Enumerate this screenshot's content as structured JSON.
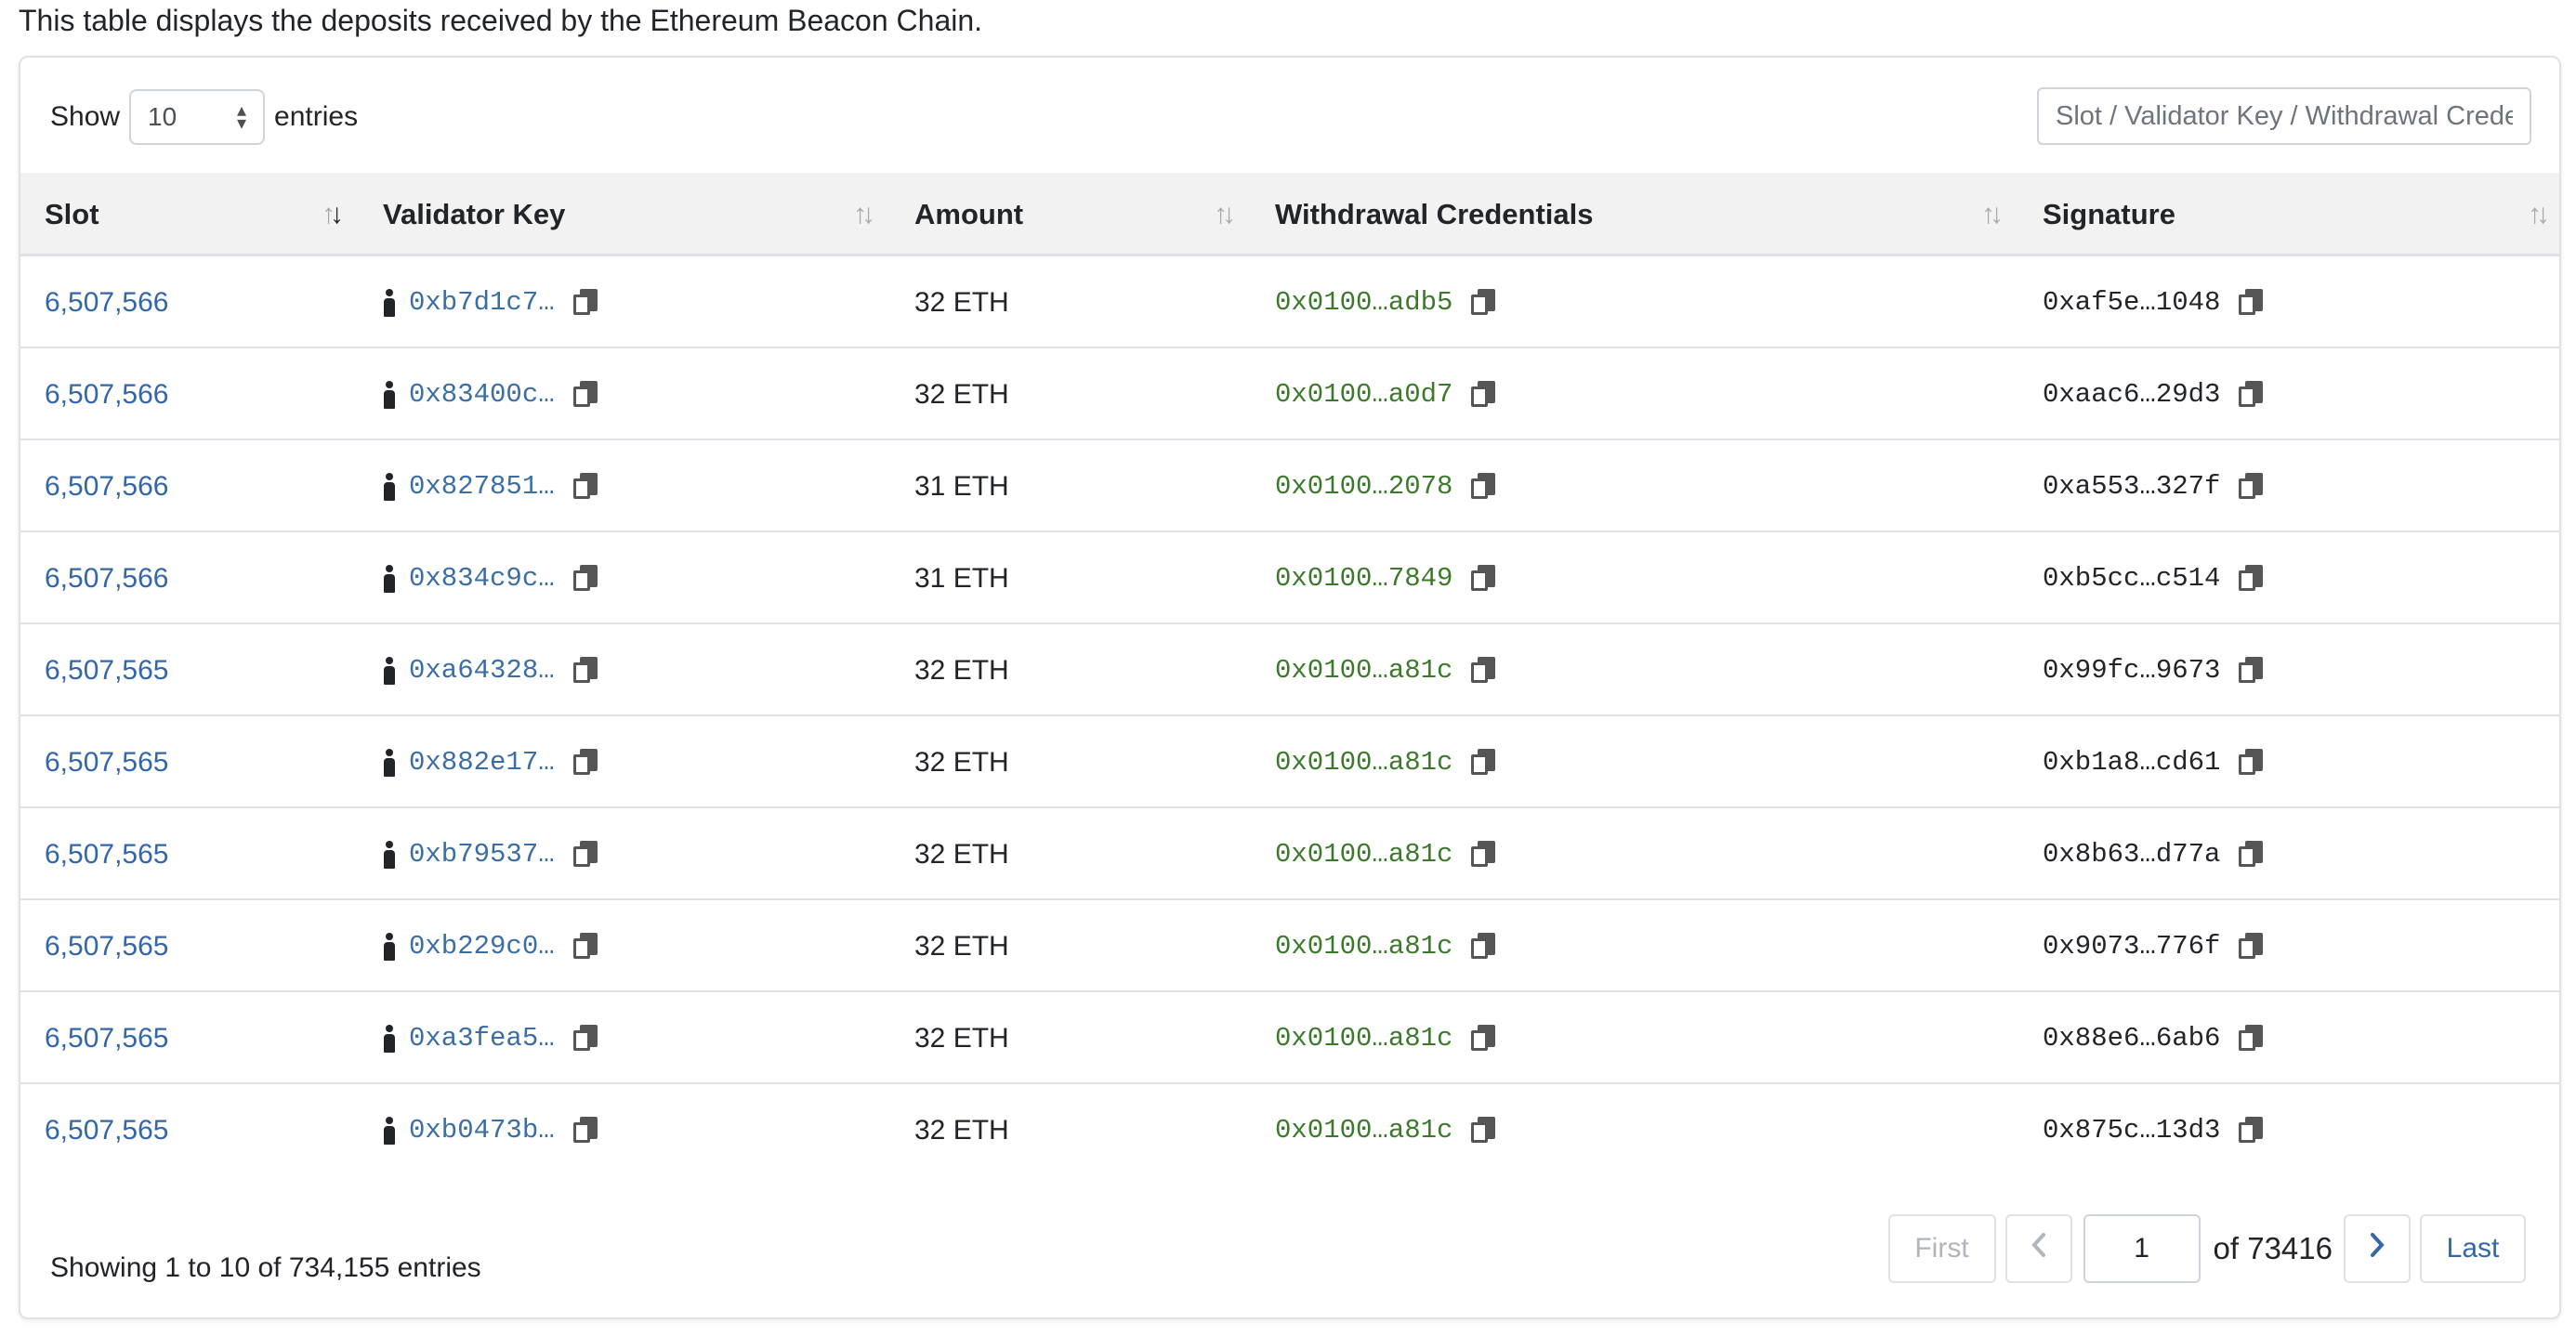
{
  "description": "This table displays the deposits received by the Ethereum Beacon Chain.",
  "length_menu": {
    "show_label": "Show",
    "selected": "10",
    "entries_label": "entries"
  },
  "search": {
    "placeholder": "Slot / Validator Key / Withdrawal Credentials / Signature"
  },
  "columns": [
    "Slot",
    "Validator Key",
    "Amount",
    "Withdrawal Credentials",
    "Signature"
  ],
  "sort": {
    "column": "Slot",
    "direction": "descending"
  },
  "rows": [
    {
      "slot": "6,507,566",
      "validator_key": "0xb7d1c7…",
      "amount": "32 ETH",
      "withdrawal_credentials": "0x0100…adb5",
      "signature": "0xaf5e…1048"
    },
    {
      "slot": "6,507,566",
      "validator_key": "0x83400c…",
      "amount": "32 ETH",
      "withdrawal_credentials": "0x0100…a0d7",
      "signature": "0xaac6…29d3"
    },
    {
      "slot": "6,507,566",
      "validator_key": "0x827851…",
      "amount": "31 ETH",
      "withdrawal_credentials": "0x0100…2078",
      "signature": "0xa553…327f"
    },
    {
      "slot": "6,507,566",
      "validator_key": "0x834c9c…",
      "amount": "31 ETH",
      "withdrawal_credentials": "0x0100…7849",
      "signature": "0xb5cc…c514"
    },
    {
      "slot": "6,507,565",
      "validator_key": "0xa64328…",
      "amount": "32 ETH",
      "withdrawal_credentials": "0x0100…a81c",
      "signature": "0x99fc…9673"
    },
    {
      "slot": "6,507,565",
      "validator_key": "0x882e17…",
      "amount": "32 ETH",
      "withdrawal_credentials": "0x0100…a81c",
      "signature": "0xb1a8…cd61"
    },
    {
      "slot": "6,507,565",
      "validator_key": "0xb79537…",
      "amount": "32 ETH",
      "withdrawal_credentials": "0x0100…a81c",
      "signature": "0x8b63…d77a"
    },
    {
      "slot": "6,507,565",
      "validator_key": "0xb229c0…",
      "amount": "32 ETH",
      "withdrawal_credentials": "0x0100…a81c",
      "signature": "0x9073…776f"
    },
    {
      "slot": "6,507,565",
      "validator_key": "0xa3fea5…",
      "amount": "32 ETH",
      "withdrawal_credentials": "0x0100…a81c",
      "signature": "0x88e6…6ab6"
    },
    {
      "slot": "6,507,565",
      "validator_key": "0xb0473b…",
      "amount": "32 ETH",
      "withdrawal_credentials": "0x0100…a81c",
      "signature": "0x875c…13d3"
    }
  ],
  "info": "Showing 1 to 10 of 734,155 entries",
  "pagination": {
    "first": "First",
    "prev_icon": "chevron-left-icon",
    "page": "1",
    "of_label": "of 73416",
    "next_icon": "chevron-right-icon",
    "last": "Last"
  },
  "colors": {
    "link": "#3366aa",
    "validator_key": "#3a6ea5",
    "withdrawal_credentials": "#3b7a2a",
    "header_bg": "#f2f2f2",
    "border": "#dee2e6"
  }
}
